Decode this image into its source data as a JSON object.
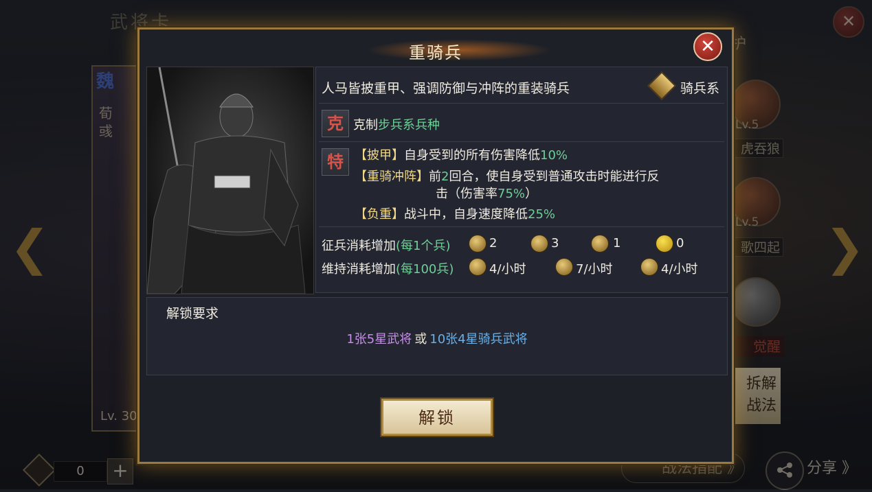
{
  "background": {
    "screen_title": "武将卡",
    "hero_faction": "魏",
    "hero_name": "荀彧",
    "hero_level": "Lv. 30",
    "close_glyph": "✕",
    "arrow_left": "❮",
    "arrow_right": "❯",
    "protect_label": "护",
    "skills": [
      {
        "level": "Lv.5",
        "name": "虎吞狼"
      },
      {
        "level": "Lv.5",
        "name": "歌四起"
      }
    ],
    "awaken_label": "觉醒",
    "disassemble_label": "拆解\n战法",
    "currency_count": "0",
    "plus_glyph": "+",
    "tactic_button": "战法指配 》",
    "share_label": "分享 》"
  },
  "modal": {
    "title": "重骑兵",
    "close_glyph": "✕",
    "description": "人马皆披重甲、强调防御与冲阵的重装骑兵",
    "troop_type": "骑兵系",
    "counter_badge": "克",
    "counter_text": "克制",
    "counter_target": "步兵系兵种",
    "trait_badge": "特",
    "traits": [
      {
        "name": "【披甲】",
        "text_a": "自身受到的所有伤害降低",
        "value": "10%",
        "text_b": ""
      },
      {
        "name": "【重骑冲阵】",
        "text_a": "前",
        "value": "2",
        "text_b": "回合，使自身受到普通攻击时能进行反"
      },
      {
        "name": "",
        "text_a": "击（伤害率",
        "value": "75%",
        "text_b": "）"
      },
      {
        "name": "【负重】",
        "text_a": "战斗中，自身速度降低",
        "value": "25%",
        "text_b": ""
      }
    ],
    "recruit_cost": {
      "label": "征兵消耗增加",
      "unit": "(每1个兵)",
      "values": [
        "2",
        "3",
        "1",
        "0"
      ]
    },
    "upkeep_cost": {
      "label": "维持消耗增加",
      "unit": "(每100兵)",
      "values": [
        "4/小时",
        "7/小时",
        "4/小时"
      ]
    },
    "unlock": {
      "title": "解锁要求",
      "option_a": "1张5星武将",
      "or": "或",
      "option_b": "10张4星骑兵武将"
    },
    "unlock_button": "解锁"
  },
  "colors": {
    "frame_gold": "#9a7a3e",
    "highlight_green": "#6fcf97",
    "purple_req": "#c68ee8",
    "blue_req": "#6ab0e8",
    "counter_red": "#d8534a"
  }
}
